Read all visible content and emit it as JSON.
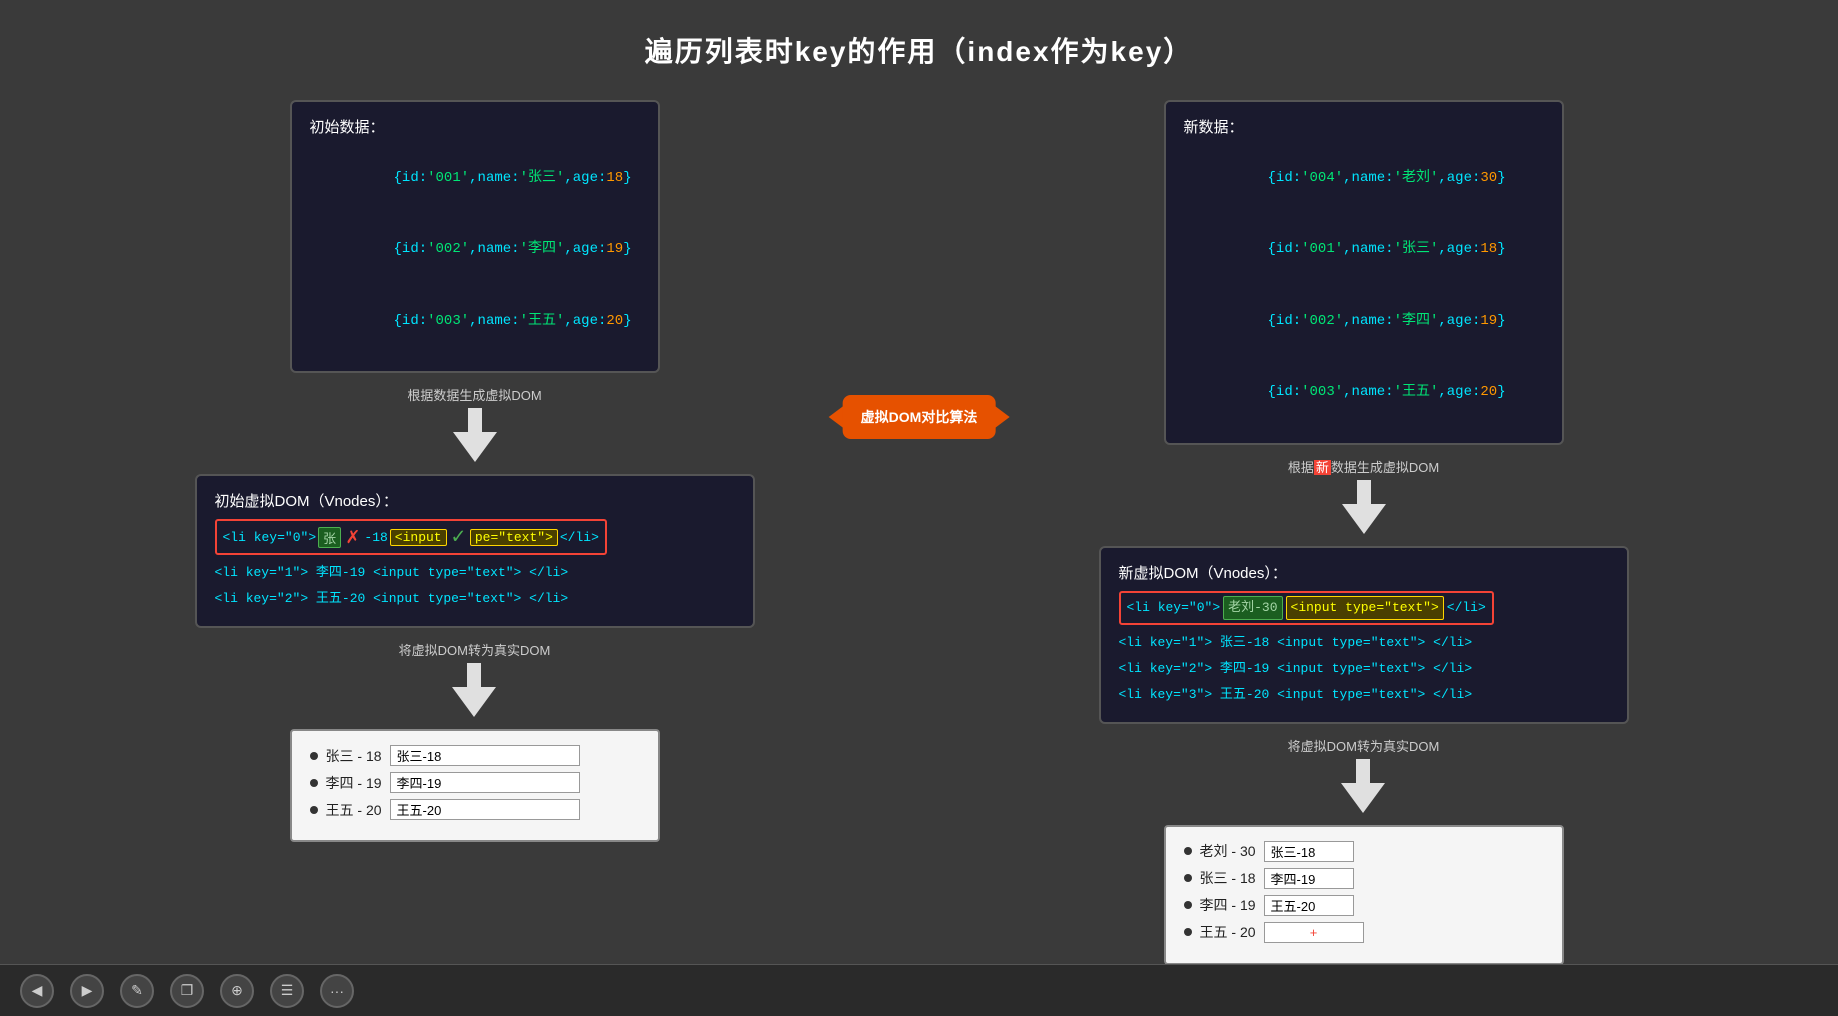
{
  "title": "遍历列表时key的作用（index作为key）",
  "left": {
    "initial_data_title": "初始数据：",
    "initial_data_lines": [
      "{id:'001',name:'张三',age:18}",
      "{id:'002',name:'李四',age:19}",
      "{id:'003',name:'王五',age:20}"
    ],
    "arrow1_label": "根据数据生成虚拟DOM",
    "vdom_title": "初始虚拟DOM（Vnodes）：",
    "vdom_lines": [
      "<li key=\"1\"> 李四-19 <input type=\"text\"> </li>",
      "<li key=\"2\"> 王五-20 <input type=\"text\"> </li>"
    ],
    "vdom_highlighted": "<li key=\"0\"> 张三-18 <input type=\"text\"> </li>",
    "arrow2_label": "将虚拟DOM转为真实DOM",
    "dom_title": "",
    "dom_rows": [
      {
        "text": "张三 - 18",
        "input_val": "张三-18"
      },
      {
        "text": "李四 - 19",
        "input_val": "李四-19"
      },
      {
        "text": "王五 - 20",
        "input_val": "王五-20"
      }
    ]
  },
  "right": {
    "new_data_title": "新数据：",
    "new_data_lines": [
      "{id:'004',name:'老刘',age:30}",
      "{id:'001',name:'张三',age:18}",
      "{id:'002',name:'李四',age:19}",
      "{id:'003',name:'王五',age:20}"
    ],
    "arrow1_label": "根据新数据生成虚拟DOM",
    "vdom_title": "新虚拟DOM（Vnodes）：",
    "vdom_lines": [
      "<li key=\"1\"> 张三-18 <input type=\"text\"> </li>",
      "<li key=\"2\"> 李四-19 <input type=\"text\"> </li>",
      "<li key=\"3\"> 王五-20 <input type=\"text\"> </li>"
    ],
    "vdom_highlighted": "<li key=\"0\">",
    "vdom_highlighted_name": "老刘-30",
    "vdom_highlighted_input": "<input type=\"text\">",
    "vdom_highlighted_end": " </li>",
    "arrow2_label": "将虚拟DOM转为真实DOM",
    "dom_rows": [
      {
        "text": "老刘 - 30",
        "input_val": "张三-18"
      },
      {
        "text": "张三 - 18",
        "input_val": "李四-19"
      },
      {
        "text": "李四 - 19",
        "input_val": "王五-20"
      },
      {
        "text": "王五 - 20",
        "input_val": ""
      }
    ]
  },
  "middle": {
    "label": "虚拟DOM对比算法"
  },
  "navbar": {
    "btn_prev": "◀",
    "btn_next": "▶",
    "btn_edit": "✎",
    "btn_copy": "❐",
    "btn_zoom": "⊕",
    "btn_menu": "☰",
    "btn_more": "···"
  }
}
